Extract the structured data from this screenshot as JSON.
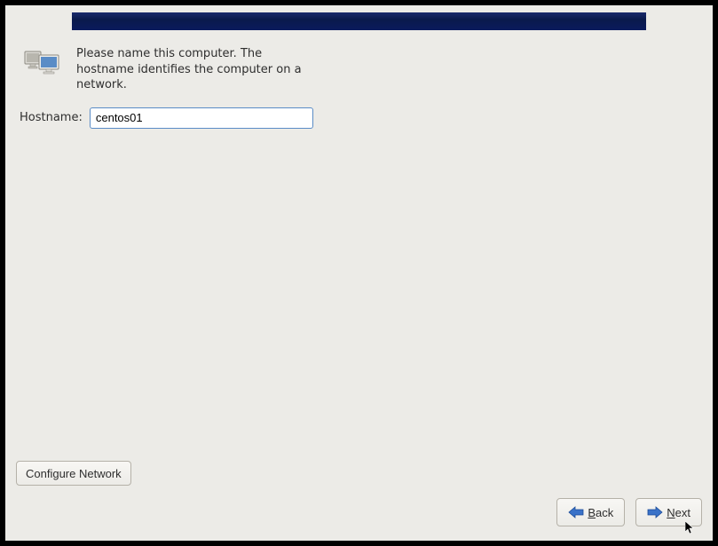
{
  "intro_text": "Please name this computer.  The hostname identifies the computer on a network.",
  "hostname": {
    "label": "Hostname:",
    "value": "centos01"
  },
  "buttons": {
    "configure_network": "Configure Network",
    "back": "Back",
    "next": "Next"
  },
  "icons": {
    "computer": "computer-icon",
    "arrow_left": "arrow-left-icon",
    "arrow_right": "arrow-right-icon"
  },
  "colors": {
    "banner_gradient_top": "#1a2a6c",
    "banner_gradient_bottom": "#0a1a5c",
    "arrow_blue": "#3a72c8",
    "background": "#ecebe7"
  }
}
